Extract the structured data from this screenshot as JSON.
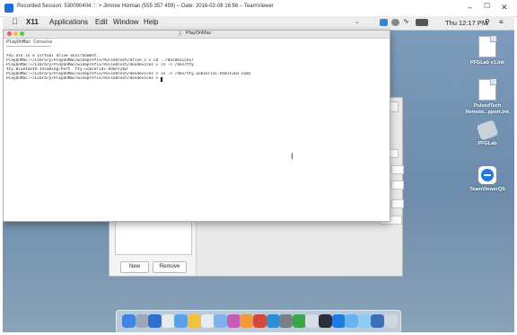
{
  "teamviewer": {
    "title": "Recorded Session: 530090404 ::: > Jimmie Holman (555 357 459) – Date: 2016-02-08 16:56 – TeamViewer",
    "controls": {
      "minimize": "–",
      "maximize": "☐",
      "close": "✕"
    }
  },
  "menubar": {
    "apple": "",
    "app_name": "X11",
    "items": [
      "Applications",
      "Edit",
      "Window",
      "Help"
    ],
    "clock": "Thu 12:17 PM",
    "search_icon": "search-icon",
    "list_icon": "list-icon"
  },
  "terminal": {
    "title": "PlayOnMac",
    "subtitle": "PlayOnMac Console",
    "lines": [
      "You are in a virtual drive environment.",
      "PlayOnMac:~/Library/PlayOnMac/wineprefix/PulsedTech/drive_c > cd ../dosdevices/",
      "PlayOnMac:~/Library/PlayOnMac/wineprefix/PulsedTech/dosdevices > ln -s /dev/tty.",
      "tty.Bluetooth-Incoming-Port  tty.usbserial-A50TF2ED",
      "PlayOnMac:~/Library/PlayOnMac/wineprefix/PulsedTech/dosdevices > ln -s /dev/tty.usbserial-A50TF2ED com5",
      "PlayOnMac:~/Library/PlayOnMac/wineprefix/PulsedTech/dosdevices > "
    ]
  },
  "manager": {
    "new_label": "New",
    "remove_label": "Remove"
  },
  "desktop": {
    "icons": [
      {
        "label": "PFGLab v1.lnk",
        "icon": "document-icon"
      },
      {
        "label": "PulsedTech Remote...pport.lnk",
        "icon": "document-icon"
      },
      {
        "label": "PFGLab",
        "icon": "pfglab-app-icon"
      },
      {
        "label": "TeamViewerQS",
        "icon": "teamviewer-icon"
      }
    ]
  },
  "dock": {
    "items": [
      "finder-icon",
      "launchpad-icon",
      "safari-icon",
      "photos-icon",
      "mail-icon",
      "notes-icon",
      "calendar-icon",
      "preview-icon",
      "itunes-icon",
      "ibooks-icon",
      "photobooth-icon",
      "app-store-icon",
      "system-preferences-icon",
      "playonmac-icon",
      "xquartz-icon",
      "x11-icon",
      "teamviewer-icon",
      "folder-icon",
      "downloads-icon",
      "finder-folder-icon",
      "trash-icon"
    ]
  }
}
